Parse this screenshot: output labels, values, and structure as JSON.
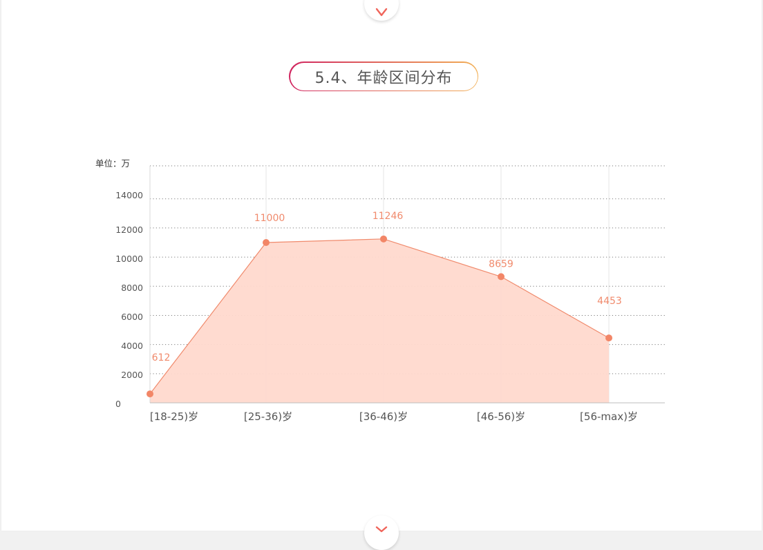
{
  "section_title": "5.4、年龄区间分布",
  "colors": {
    "line": "#f08a6c",
    "fill": "#ffd9ce",
    "point": "#f28667",
    "label": "#f08a6c",
    "axis_text": "#555555",
    "title_gradient_start": "#d0245f",
    "title_gradient_end": "#f2b056"
  },
  "icons": {
    "top_nav": "chevron-down-icon",
    "bottom_nav": "chevron-down-icon"
  },
  "chart_data": {
    "type": "area",
    "unit_label": "单位：万",
    "categories": [
      "[18-25)岁",
      "[25-36)岁",
      "[36-46)岁",
      "[46-56)岁",
      "[56-max)岁"
    ],
    "values": [
      612,
      11000,
      11246,
      8659,
      4453
    ],
    "data_labels": [
      "612",
      "11000",
      "11246",
      "8659",
      "4453"
    ],
    "y_ticks": [
      0,
      2000,
      4000,
      6000,
      8000,
      10000,
      12000,
      14000
    ],
    "ylim": [
      0,
      16000
    ],
    "grid": true
  }
}
